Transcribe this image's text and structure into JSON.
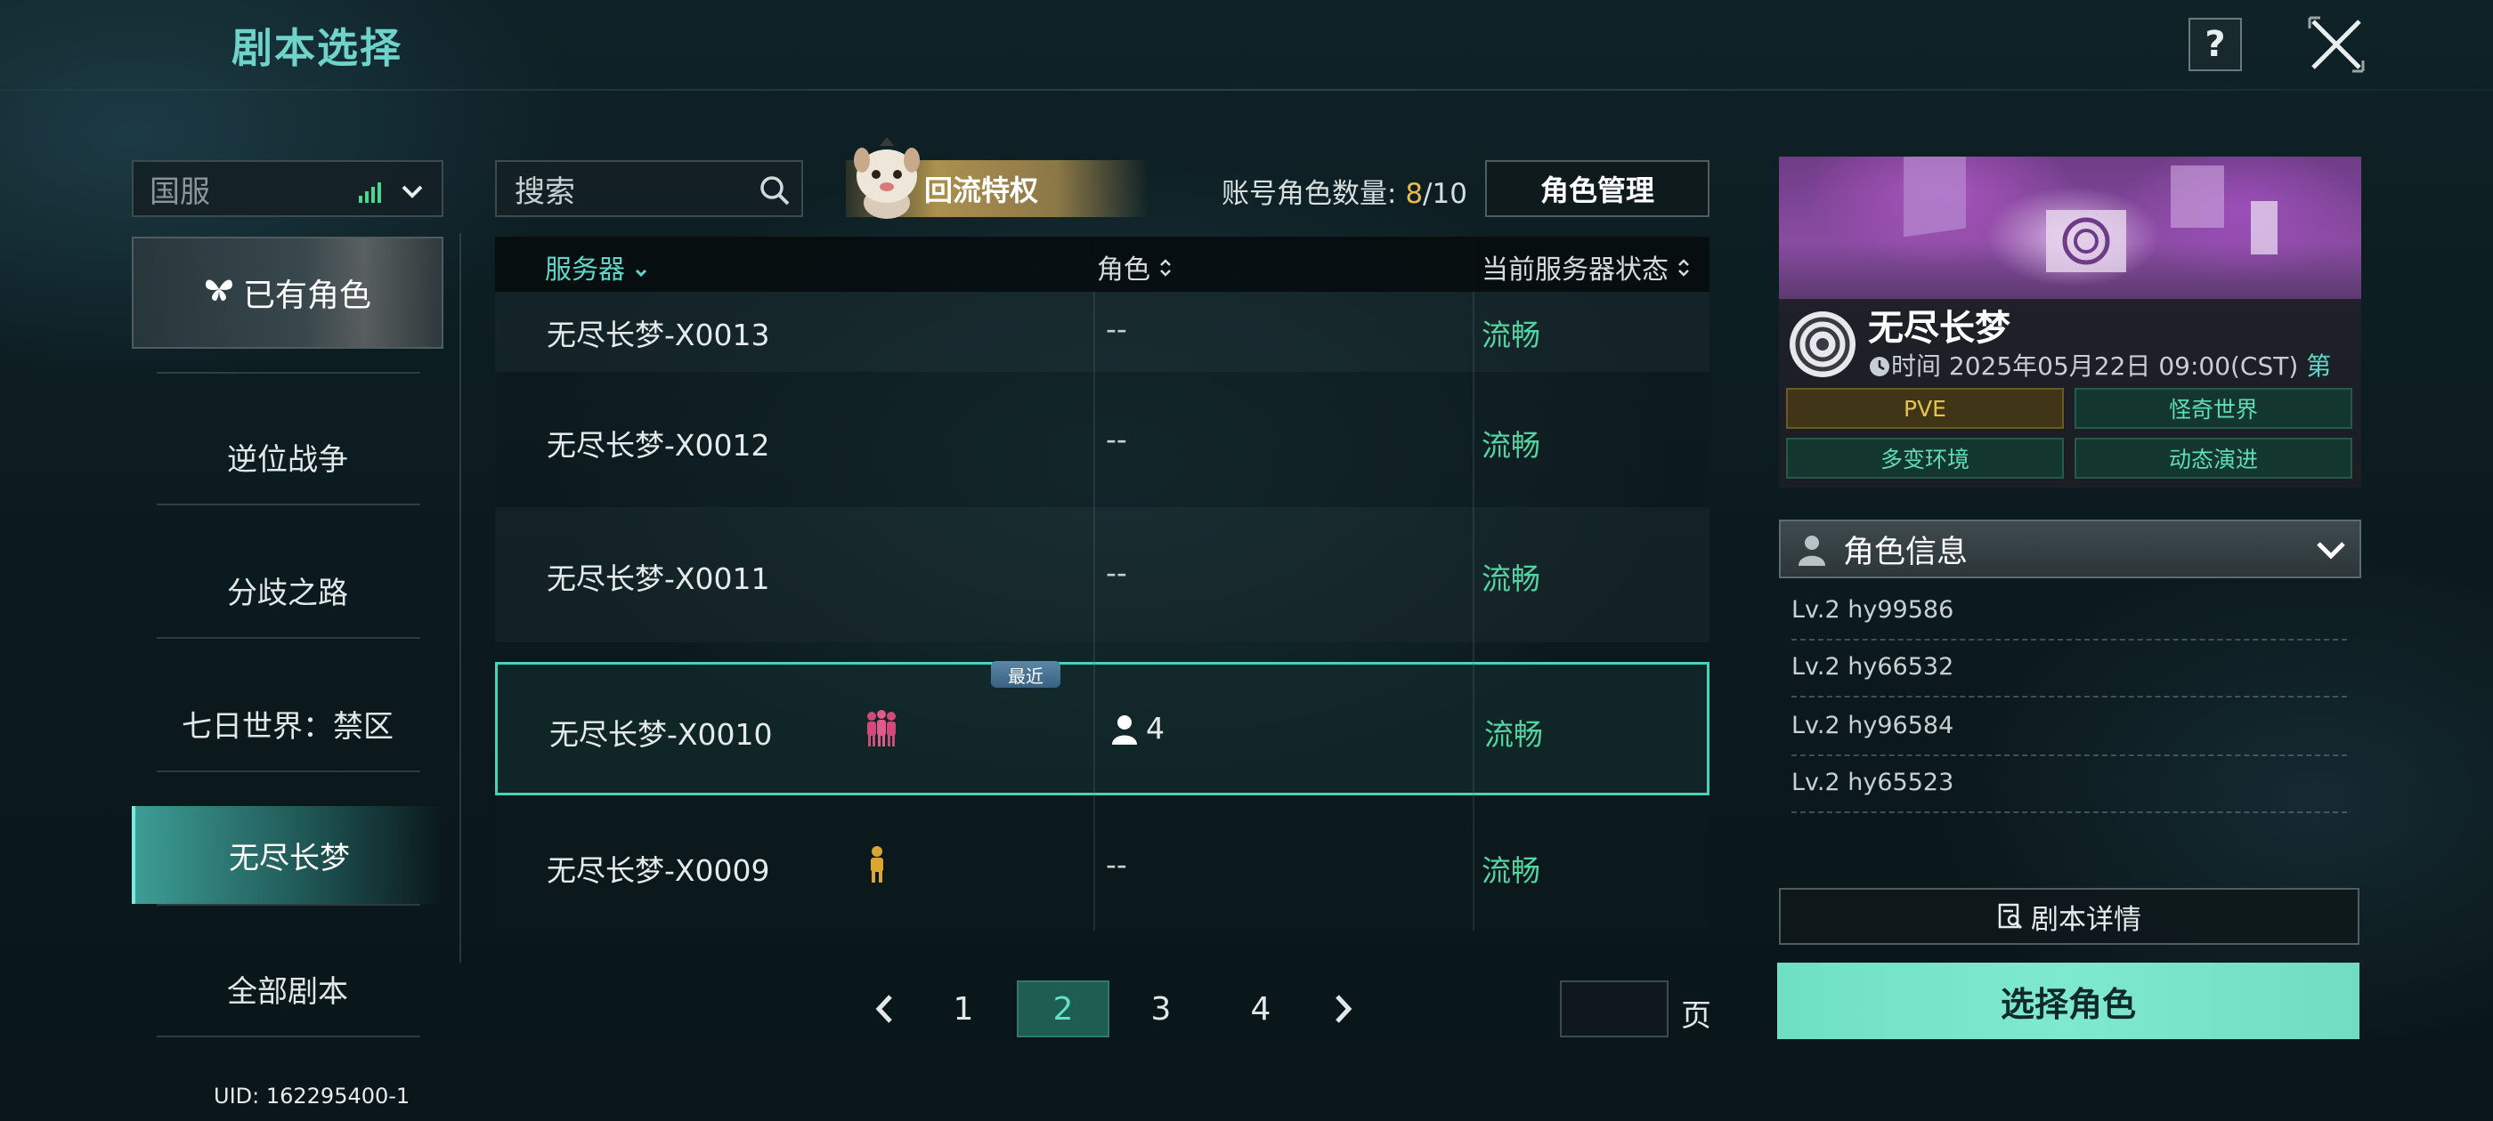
{
  "header": {
    "title": "剧本选择",
    "help_label": "?"
  },
  "sidebar": {
    "server_region": "国服",
    "owned_roles_label": "已有角色",
    "items": [
      {
        "label": "逆位战争"
      },
      {
        "label": "分歧之路"
      },
      {
        "label": "七日世界：禁区"
      },
      {
        "label": "无尽长梦",
        "active": true
      },
      {
        "label": "全部剧本"
      }
    ],
    "uid": "UID: 162295400-1"
  },
  "toolbar": {
    "search_placeholder": "搜索",
    "return_privilege_label": "回流特权",
    "role_count_label": "账号角色数量: ",
    "role_count_current": "8",
    "role_count_max": "/10",
    "role_manage_label": "角色管理"
  },
  "table": {
    "columns": [
      "服务器",
      "角色",
      "当前服务器状态"
    ],
    "recent_badge": "最近",
    "rows": [
      {
        "server": "无尽长梦-X0013",
        "role": "--",
        "status": "流畅"
      },
      {
        "server": "无尽长梦-X0012",
        "role": "--",
        "status": "流畅"
      },
      {
        "server": "无尽长梦-X0011",
        "role": "--",
        "status": "流畅"
      },
      {
        "server": "无尽长梦-X0010",
        "role": "4",
        "status": "流畅",
        "selected": true,
        "recent": true,
        "population_icon": "crowd-pink-icon"
      },
      {
        "server": "无尽长梦-X0009",
        "role": "--",
        "status": "流畅",
        "population_icon": "person-gold-icon"
      }
    ]
  },
  "pagination": {
    "pages": [
      "1",
      "2",
      "3",
      "4"
    ],
    "current": "2",
    "input_value": "",
    "suffix": "页"
  },
  "script_card": {
    "name": "无尽长梦",
    "time_label": "时间 2025年05月22日 09:00(CST)",
    "time_tail": " 第",
    "tags": [
      "PVE",
      "怪奇世界",
      "多变环境",
      "动态演进"
    ]
  },
  "role_info": {
    "header": "角色信息",
    "roles": [
      "Lv.2 hy99586",
      "Lv.2 hy66532",
      "Lv.2 hy96584",
      "Lv.2 hy65523"
    ]
  },
  "buttons": {
    "script_details": "剧本详情",
    "select_role": "选择角色"
  },
  "colors": {
    "accent": "#5fd6c8",
    "status_good": "#54d39f",
    "gold": "#e7b94a",
    "select_button": "#7fe9cf"
  }
}
